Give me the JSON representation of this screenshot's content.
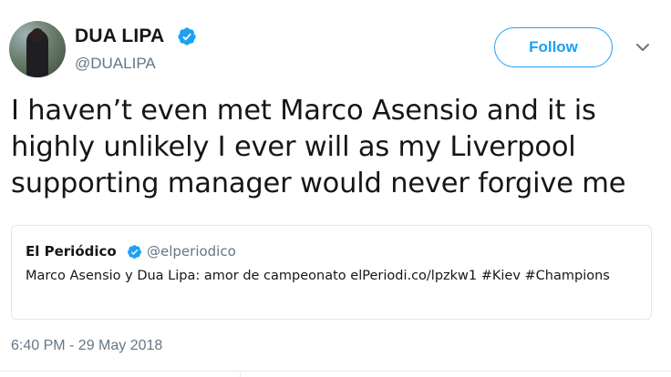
{
  "user": {
    "name": "DUA LIPA",
    "handle": "@DUALIPA",
    "verified": true
  },
  "follow_button": {
    "label": "Follow"
  },
  "menu": {
    "icon": "chevron-down-icon"
  },
  "tweet": {
    "text": "I haven’t even met Marco Asensio and it is highly unlikely I ever will as my Liverpool supporting manager would never forgive me",
    "timestamp": "6:40 PM - 29 May 2018"
  },
  "quoted_tweet": {
    "name": "El Periódico",
    "handle": "@elperiodico",
    "verified": true,
    "text": "Marco Asensio y Dua Lipa: amor de campeonato elPeriodi.co/lpzkw1 #Kiev #Champions"
  },
  "colors": {
    "accent": "#1da1f2",
    "text": "#14171a",
    "muted": "#657786",
    "border": "#e1e8ed"
  }
}
